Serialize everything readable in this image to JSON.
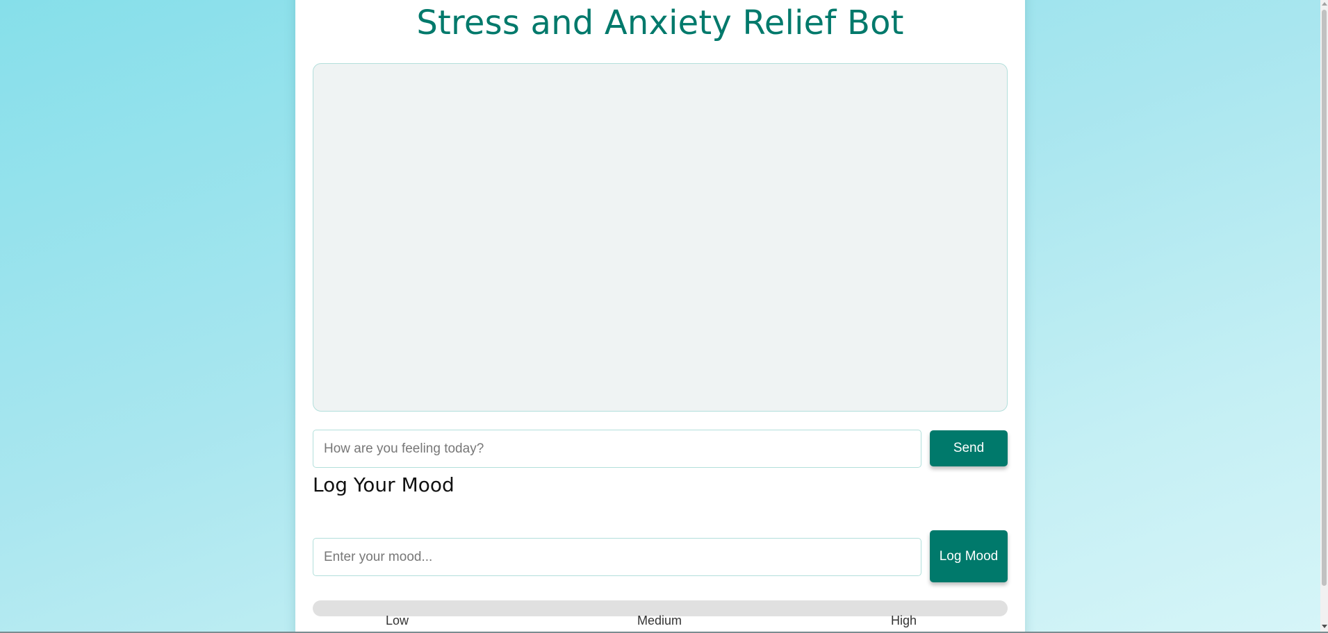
{
  "app": {
    "title": "Stress and Anxiety Relief Bot"
  },
  "chat": {
    "messages": [],
    "input_value": "",
    "input_placeholder": "How are you feeling today?",
    "send_label": "Send"
  },
  "mood": {
    "heading": "Log Your Mood",
    "input_value": "",
    "input_placeholder": "Enter your mood...",
    "log_label": "Log Mood",
    "level_fraction": 0,
    "scale_labels": [
      "Low",
      "Medium",
      "High"
    ]
  },
  "colors": {
    "accent": "#00796b",
    "chat_background": "#eff3f3",
    "border": "#b2dfdb",
    "track": "#e0e0e0"
  }
}
